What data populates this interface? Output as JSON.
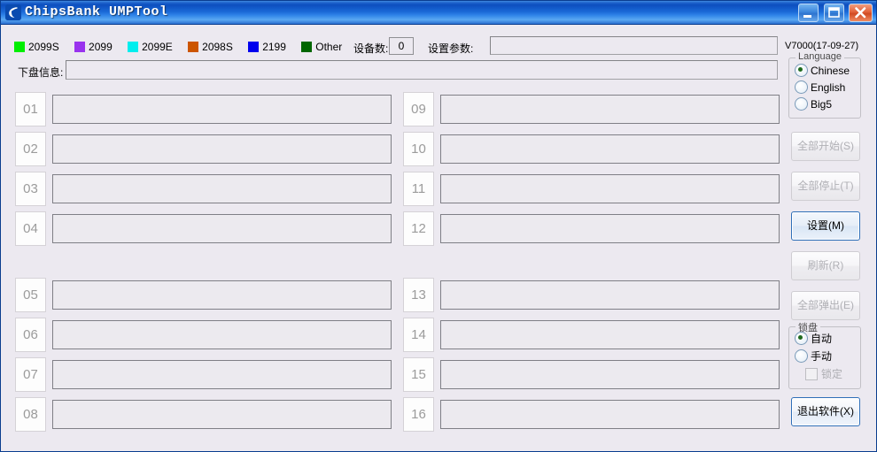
{
  "window": {
    "title": "ChipsBank UMPTool",
    "icon": "chipsbank-logo-icon",
    "controls": {
      "minimize": "minimize-button",
      "maximize": "maximize-button",
      "close": "close-button"
    }
  },
  "legend": [
    {
      "label": "2099S",
      "color": "#00ee00"
    },
    {
      "label": "2099",
      "color": "#9933ee"
    },
    {
      "label": "2099E",
      "color": "#00eeee"
    },
    {
      "label": "2098S",
      "color": "#cc5500"
    },
    {
      "label": "2199",
      "color": "#0000ee"
    },
    {
      "label": "Other",
      "color": "#006600"
    }
  ],
  "toolbar": {
    "device_count_label": "设备数:",
    "device_count_value": "0",
    "param_label": "设置参数:",
    "param_value": "",
    "param_placeholder": "",
    "version": "V7000(17-09-27)"
  },
  "info_bar": {
    "label": "下盘信息:",
    "value": "",
    "placeholder": ""
  },
  "slots": [
    {
      "num": "01",
      "status": ""
    },
    {
      "num": "02",
      "status": ""
    },
    {
      "num": "03",
      "status": ""
    },
    {
      "num": "04",
      "status": ""
    },
    {
      "num": "05",
      "status": ""
    },
    {
      "num": "06",
      "status": ""
    },
    {
      "num": "07",
      "status": ""
    },
    {
      "num": "08",
      "status": ""
    },
    {
      "num": "09",
      "status": ""
    },
    {
      "num": "10",
      "status": ""
    },
    {
      "num": "11",
      "status": ""
    },
    {
      "num": "12",
      "status": ""
    },
    {
      "num": "13",
      "status": ""
    },
    {
      "num": "14",
      "status": ""
    },
    {
      "num": "15",
      "status": ""
    },
    {
      "num": "16",
      "status": ""
    }
  ],
  "sidebar": {
    "language": {
      "title": "Language",
      "options": [
        {
          "label": "Chinese",
          "selected": true
        },
        {
          "label": "English",
          "selected": false
        },
        {
          "label": "Big5",
          "selected": false
        }
      ]
    },
    "buttons": [
      {
        "label": "全部开始(S)",
        "enabled": false
      },
      {
        "label": "全部停止(T)",
        "enabled": false
      },
      {
        "label": "设置(M)",
        "enabled": true
      },
      {
        "label": "刷新(R)",
        "enabled": false
      },
      {
        "label": "全部弹出(E)",
        "enabled": false
      }
    ],
    "lock": {
      "title": "锁盘",
      "options": [
        {
          "label": "自动",
          "selected": true
        },
        {
          "label": "手动",
          "selected": false
        }
      ],
      "checkbox": {
        "label": "锁定",
        "checked": false,
        "enabled": false
      }
    },
    "exit_button": {
      "label": "退出软件(X)"
    }
  }
}
